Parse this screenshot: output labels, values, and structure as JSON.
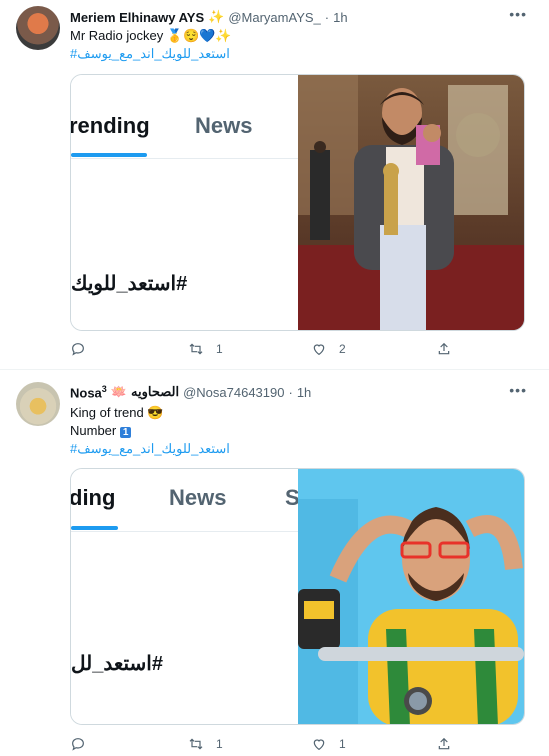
{
  "tweets": [
    {
      "name": "Meriem Elhinawy AYS",
      "name_suffix": "✨",
      "handle": "@MaryamAYS_",
      "separator": "·",
      "time": "1h",
      "text_line": "Mr Radio jockey",
      "text_emojis": "🥇😌💙✨",
      "hashtag": "#استعد_للويك_اند_مع_يوسف",
      "media": {
        "active_tab": "rending",
        "second_tab": "News",
        "trend_text": "#استعد_للويك"
      },
      "stats": {
        "reply": "",
        "retweet": "1",
        "like": "2"
      }
    },
    {
      "name": "Nosa",
      "name_sup": "3",
      "name_extra": "الصحاويه",
      "name_emoji": "🪷",
      "handle": "@Nosa74643190",
      "separator": "·",
      "time": "1h",
      "text_line_1": "King of trend",
      "text_line_1_emoji": "😎",
      "text_line_2": "Number",
      "text_line_2_key": "1",
      "hashtag": "#استعد_للويك_اند_مع_يوسف",
      "media": {
        "active_tab": "ding",
        "second_tab": "News",
        "third_tab_fragment": "S",
        "trend_text": "#استعد_لل"
      },
      "stats": {
        "reply": "",
        "retweet": "1",
        "like": "1"
      }
    }
  ],
  "icons": [
    "more-icon",
    "reply-icon",
    "retweet-icon",
    "like-icon",
    "share-icon"
  ],
  "colors": {
    "accent": "#1d9bf0",
    "muted": "#536471",
    "text": "#0f1419",
    "border": "#cfd9de"
  }
}
